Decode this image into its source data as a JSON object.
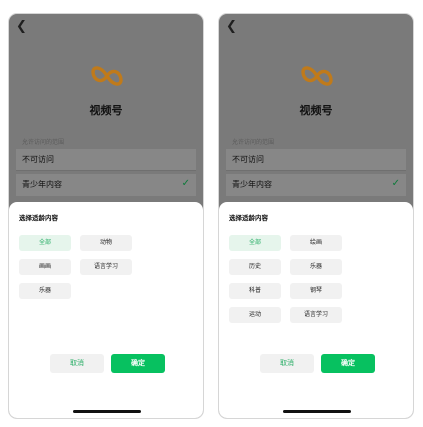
{
  "phones": [
    {
      "title": "视频号",
      "section_label": "允许访问的范围",
      "rows": [
        "不可访问",
        "青少年内容"
      ],
      "sheet_title": "选择适龄内容",
      "options": [
        {
          "label": "全部",
          "selected": true
        },
        {
          "label": "动物",
          "selected": false
        },
        {
          "label": "画画",
          "selected": false
        },
        {
          "label": "语言学习",
          "selected": false
        },
        {
          "label": "乐器",
          "selected": false
        }
      ],
      "cancel_label": "取消",
      "confirm_label": "确定"
    },
    {
      "title": "视频号",
      "section_label": "允许访问的范围",
      "rows": [
        "不可访问",
        "青少年内容"
      ],
      "sheet_title": "选择适龄内容",
      "options": [
        {
          "label": "全部",
          "selected": true
        },
        {
          "label": "绘画",
          "selected": false
        },
        {
          "label": "历史",
          "selected": false
        },
        {
          "label": "乐器",
          "selected": false
        },
        {
          "label": "科普",
          "selected": false
        },
        {
          "label": "钢琴",
          "selected": false
        },
        {
          "label": "运动",
          "selected": false
        },
        {
          "label": "语言学习",
          "selected": false
        }
      ],
      "cancel_label": "取消",
      "confirm_label": "确定"
    }
  ],
  "colors": {
    "accent": "#07c160",
    "selected_bg": "#e6f5ec",
    "overlay": "#7a7a7a",
    "logo": "#c07a1a",
    "check": "#0e7a3a"
  },
  "icons": {
    "back": "chevron-left-icon",
    "logo": "channels-logo-icon",
    "check": "checkmark-icon"
  }
}
